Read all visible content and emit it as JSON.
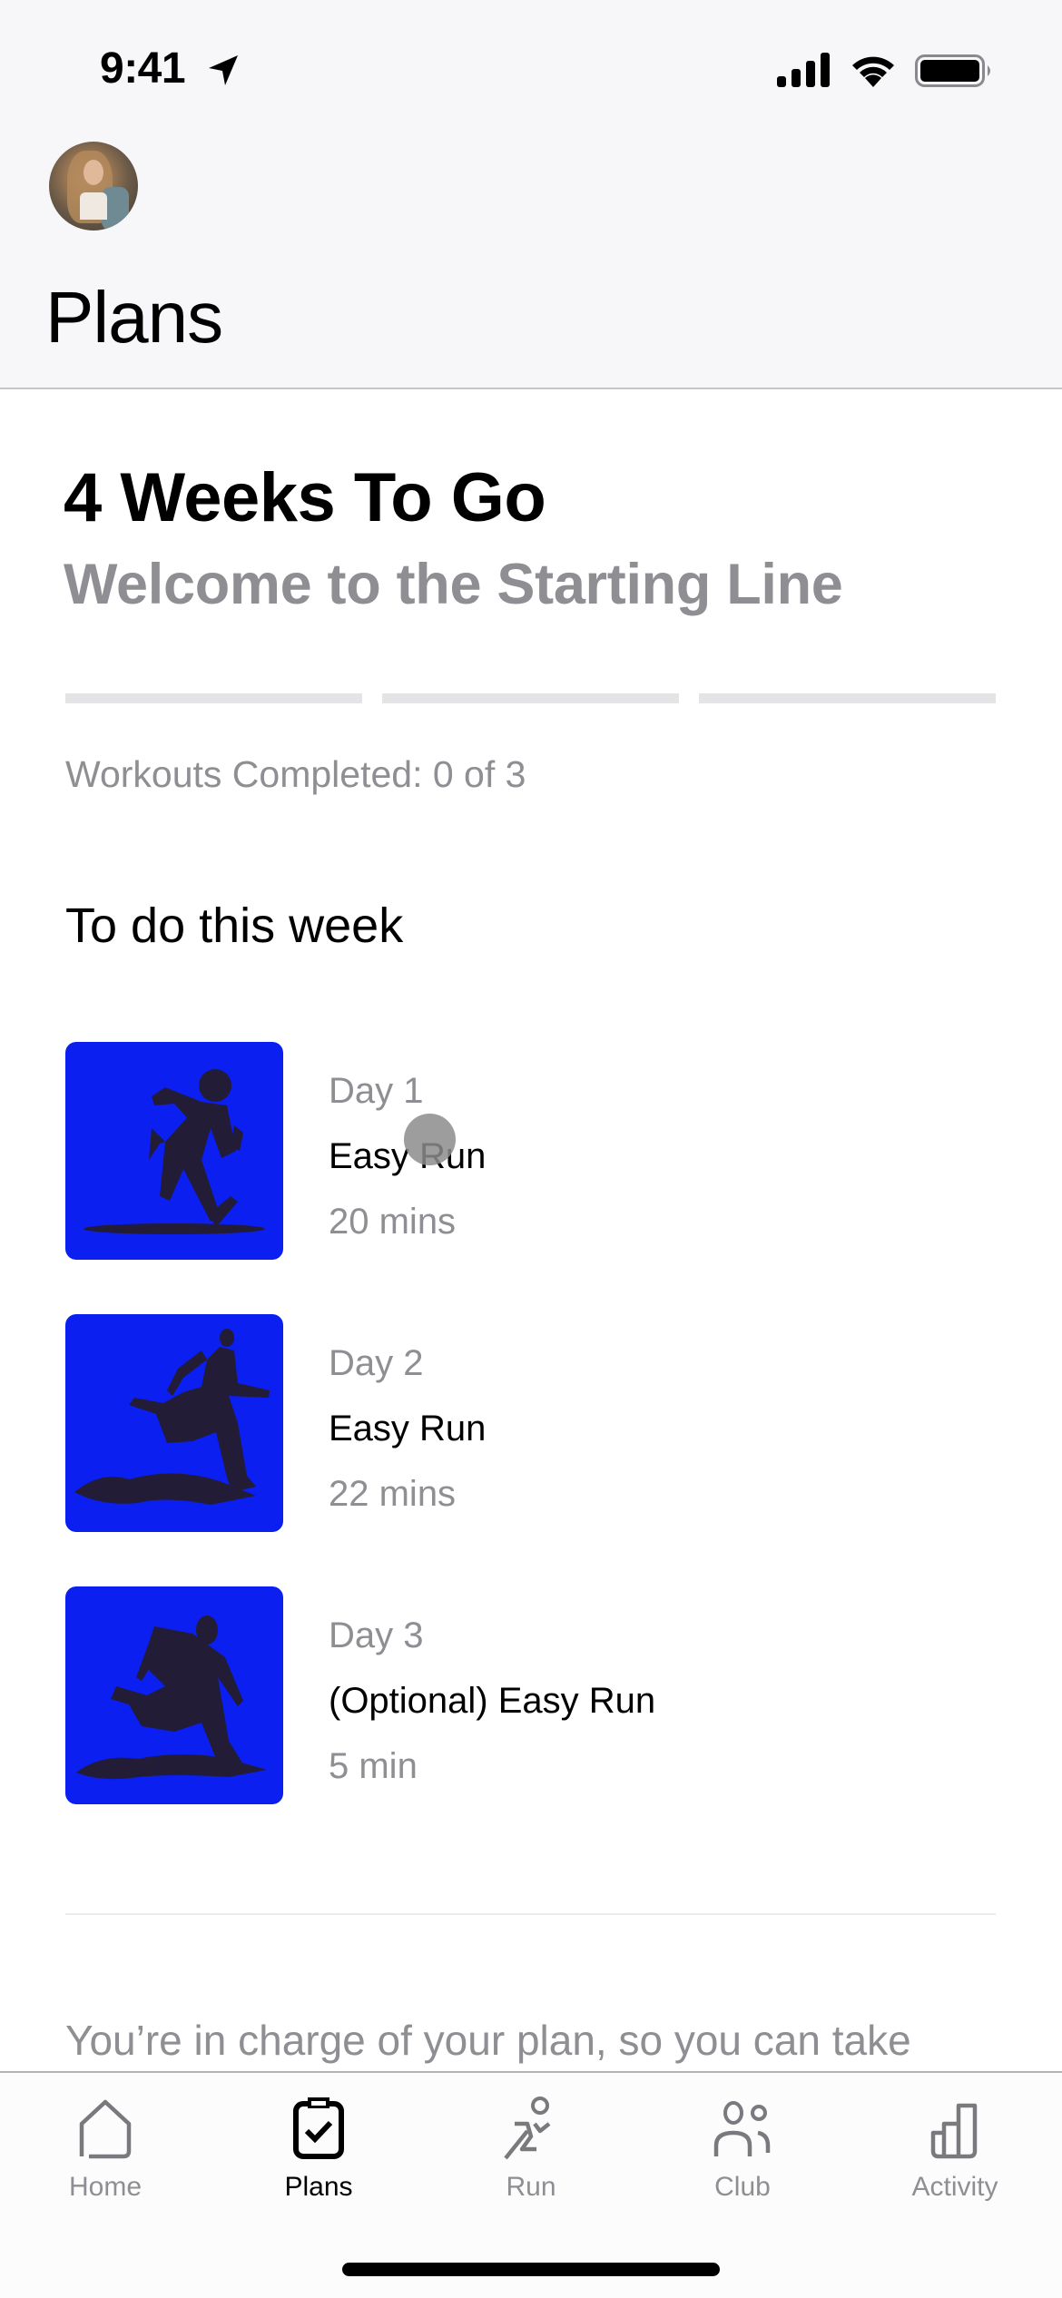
{
  "status_bar": {
    "time": "9:41",
    "icons": [
      "location-arrow-icon",
      "cellular-signal-icon",
      "wifi-icon",
      "battery-icon"
    ]
  },
  "header": {
    "avatar": "profile-avatar",
    "title": "Plans"
  },
  "plan": {
    "title": "4 Weeks To Go",
    "subtitle": "Welcome to the Starting Line",
    "progress": {
      "completed": 0,
      "total": 3
    },
    "completed_label": "Workouts Completed: 0 of 3"
  },
  "week": {
    "title": "To do this week",
    "workouts": [
      {
        "day": "Day 1",
        "name": "Easy Run",
        "duration": "20 mins",
        "image": "runner-illustration-1"
      },
      {
        "day": "Day 2",
        "name": "Easy Run",
        "duration": "22 mins",
        "image": "runner-illustration-2"
      },
      {
        "day": "Day 3",
        "name": "(Optional) Easy Run",
        "duration": "5 min",
        "image": "runner-illustration-3"
      }
    ]
  },
  "footer": {
    "text": "You’re in charge of your plan, so you can take"
  },
  "tabbar": {
    "tabs": [
      {
        "label": "Home",
        "icon": "home-icon",
        "active": false
      },
      {
        "label": "Plans",
        "icon": "clipboard-check-icon",
        "active": true
      },
      {
        "label": "Run",
        "icon": "runner-icon",
        "active": false
      },
      {
        "label": "Club",
        "icon": "people-icon",
        "active": false
      },
      {
        "label": "Activity",
        "icon": "bar-chart-icon",
        "active": false
      }
    ]
  },
  "colors": {
    "accent_tile": "#0a1ff0",
    "figure": "#221c36",
    "secondary_text": "#8e8e93",
    "progress_track": "#e4e4e7",
    "header_bg": "#f7f6f8"
  }
}
